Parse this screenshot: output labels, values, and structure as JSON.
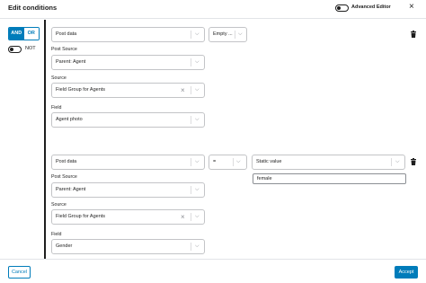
{
  "dialog": {
    "title": "Edit conditions",
    "advanced_editor_label": "Advanced Editor",
    "close_glyph": "×"
  },
  "logic": {
    "and_label": "AND",
    "or_label": "OR",
    "not_label": "NOT",
    "selected": "AND"
  },
  "conditions": [
    {
      "subject": "Post data",
      "operator": "Empty ...",
      "post_source_label": "Post Source",
      "post_source": "Parent: Agent",
      "source_label": "Source",
      "source": "Field Group for Agents",
      "field_label": "Field",
      "field": "Agent photo"
    },
    {
      "subject": "Post data",
      "operator": "=",
      "value_type": "Static value",
      "value": "female",
      "post_source_label": "Post Source",
      "post_source": "Parent: Agent",
      "source_label": "Source",
      "source": "Field Group for Agents",
      "field_label": "Field",
      "field": "Gender"
    }
  ],
  "footer": {
    "cancel_label": "Cancel",
    "accept_label": "Accept"
  },
  "colors": {
    "accent": "#007cba",
    "border": "#c3c4c7",
    "text": "#1e1e1e"
  },
  "icons": {
    "chevron": "chevron-down-icon",
    "clear": "clear-icon",
    "trash": "trash-icon"
  }
}
